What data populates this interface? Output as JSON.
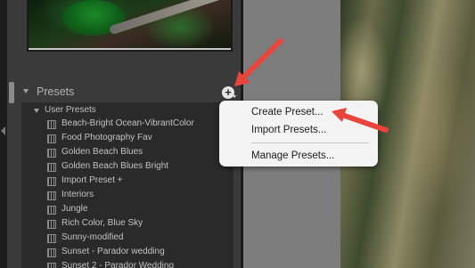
{
  "presets_panel": {
    "title": "Presets",
    "add_button_symbol": "+",
    "groups": [
      {
        "label": "User Presets",
        "presets": [
          "Beach-Bright Ocean-VibrantColor",
          "Food Photography Fav",
          "Golden Beach Blues",
          "Golden Beach Blues Bright",
          "Import Preset  +",
          "Interiors",
          "Jungle",
          "Rich Color, Blue Sky",
          "Sunny-modified",
          "Sunset - Parador wedding",
          "Sunset 2 - Parador Wedding"
        ]
      }
    ]
  },
  "context_menu": {
    "items": [
      "Create Preset...",
      "Import Presets...",
      "Manage Presets..."
    ]
  },
  "annotation_color": "#e8453c"
}
